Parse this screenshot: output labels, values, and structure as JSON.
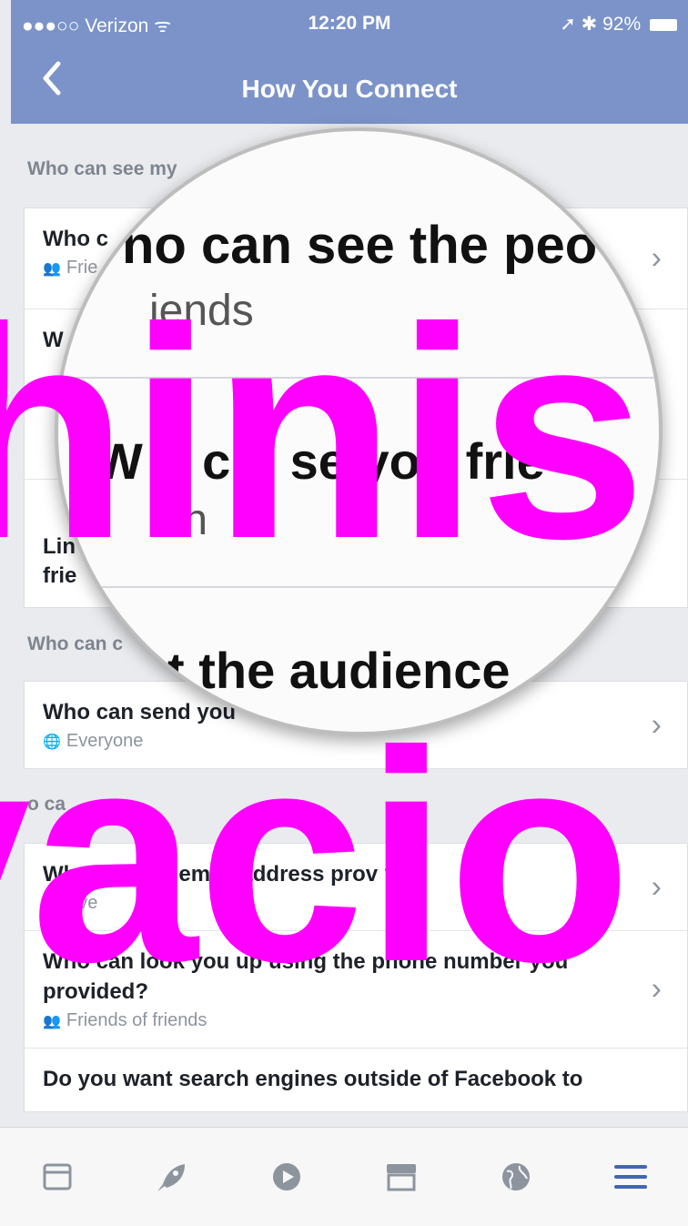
{
  "status_bar": {
    "carrier": "●●●○○ Verizon",
    "wifi": "ᯤ",
    "time": "12:20 PM",
    "battery": "92%"
  },
  "nav": {
    "back_icon": "chevron-left-icon",
    "title": "How You Connect"
  },
  "sections": [
    {
      "header": "Who can see my",
      "rows": [
        {
          "title": "Who c",
          "subtitle": "Frie",
          "icon": "friends-icon"
        },
        {
          "title": "W",
          "subtitle": "",
          "icon": ""
        },
        {
          "title": "Lin",
          "subtitle": "frie",
          "icon": ""
        }
      ]
    },
    {
      "header": "Who can c",
      "rows": [
        {
          "title": "Who can send you",
          "subtitle": "Everyone",
          "icon": "globe-icon"
        }
      ]
    },
    {
      "header": "o ca",
      "rows": [
        {
          "title": "Who c usir e email address prov ?",
          "subtitle": "Eve",
          "icon": "globe-icon"
        },
        {
          "title": "Who can look you up using the phone number you provided?",
          "subtitle": "Friends of friends",
          "icon": "friends-icon"
        },
        {
          "title": "Do you want search engines outside of Facebook to",
          "subtitle": "",
          "icon": ""
        }
      ]
    }
  ],
  "magnifier": {
    "line1": "no can see the peo",
    "line2": "iends",
    "line3": "W o c n se you frie",
    "line4": "ien",
    "line5": "t the audience"
  },
  "overlay": {
    "word1": "hinis",
    "word2": "vacio",
    "color": "#ff00ff"
  },
  "tabbar": {
    "items": [
      "news-feed-icon",
      "rocket-icon",
      "video-play-icon",
      "marketplace-icon",
      "globe-icon",
      "menu-icon"
    ]
  },
  "colors": {
    "header_blue": "#7b93c9",
    "background": "#e9ebee",
    "accent_menu": "#4267b2"
  }
}
